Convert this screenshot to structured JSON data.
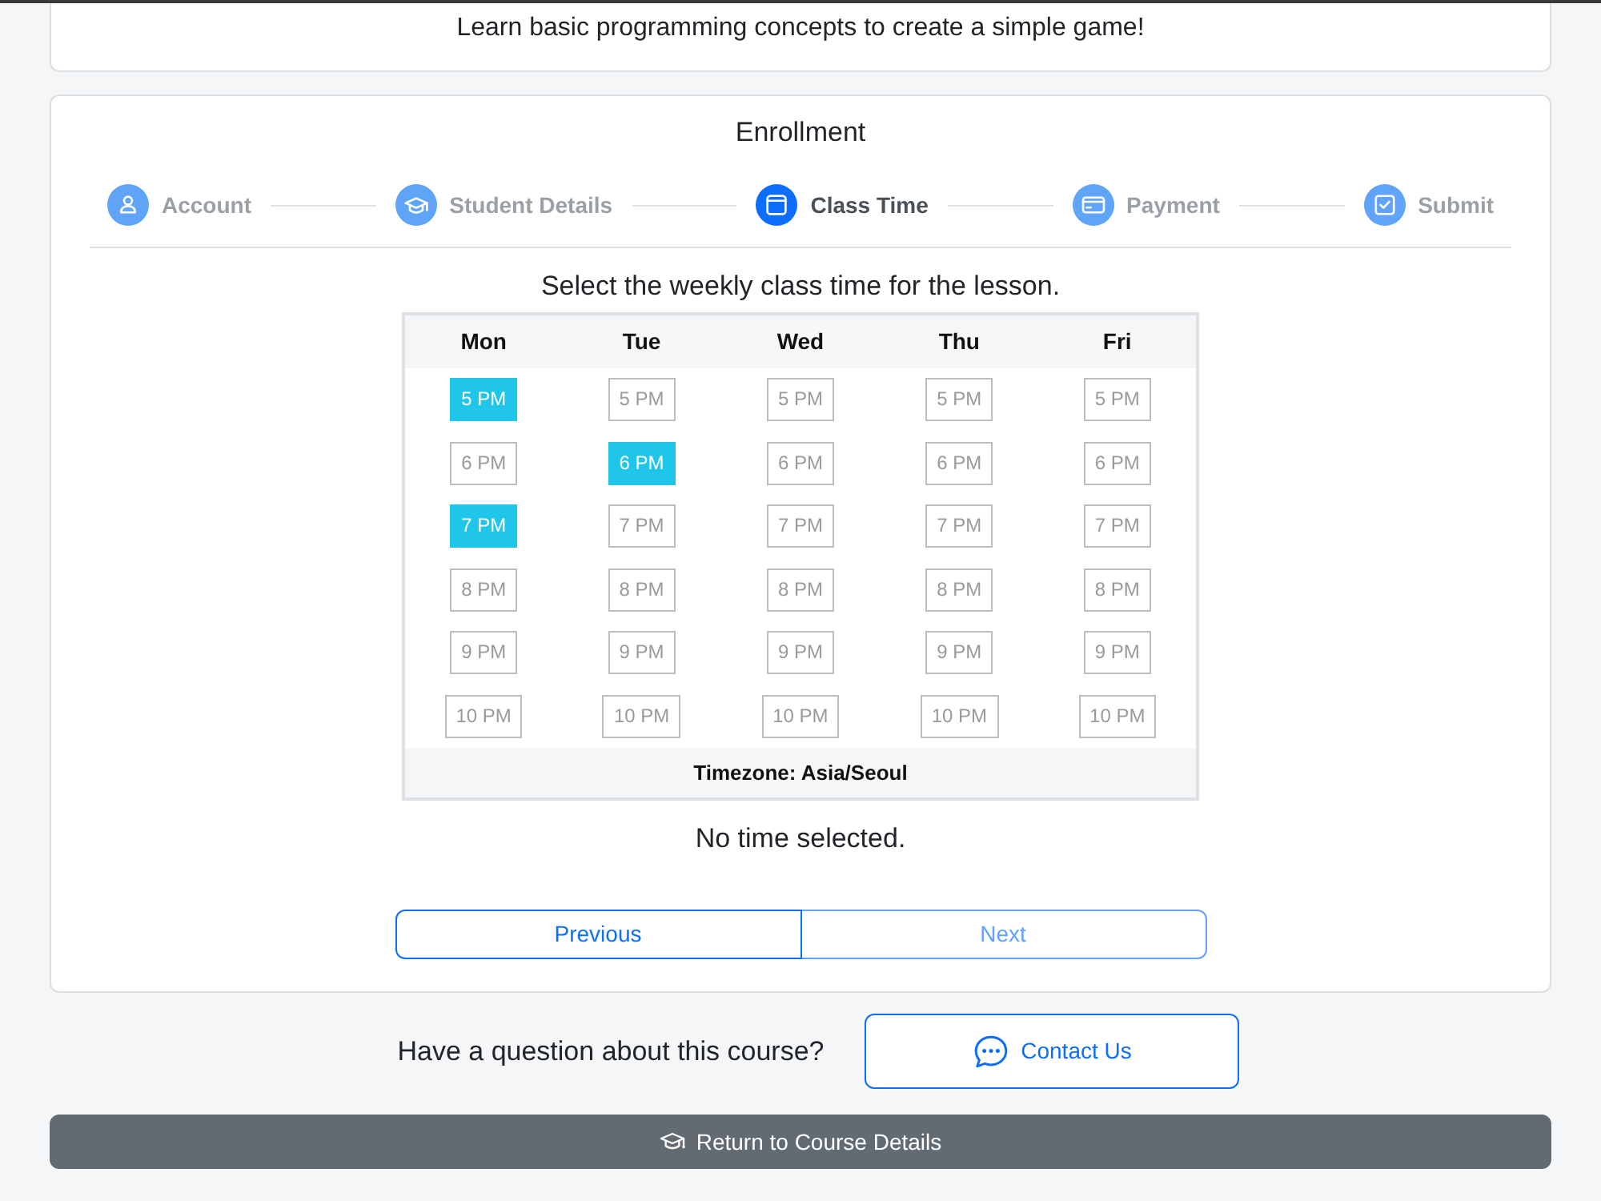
{
  "course_card": {
    "description": "Learn basic programming concepts to create a simple game!"
  },
  "enrollment": {
    "title": "Enrollment",
    "steps": [
      {
        "label": "Account",
        "selected": false
      },
      {
        "label": "Student Details",
        "selected": false
      },
      {
        "label": "Class Time",
        "selected": true
      },
      {
        "label": "Payment",
        "selected": false
      },
      {
        "label": "Submit",
        "selected": false
      }
    ],
    "prompt": "Select the weekly class time for the lesson.",
    "schedule": {
      "days": [
        {
          "label": "Mon",
          "slots": [
            {
              "label": "5 PM",
              "selected": true
            },
            {
              "label": "6 PM",
              "selected": false
            },
            {
              "label": "7 PM",
              "selected": true
            },
            {
              "label": "8 PM",
              "selected": false
            },
            {
              "label": "9 PM",
              "selected": false
            },
            {
              "label": "10 PM",
              "selected": false
            }
          ]
        },
        {
          "label": "Tue",
          "slots": [
            {
              "label": "5 PM",
              "selected": false
            },
            {
              "label": "6 PM",
              "selected": true
            },
            {
              "label": "7 PM",
              "selected": false
            },
            {
              "label": "8 PM",
              "selected": false
            },
            {
              "label": "9 PM",
              "selected": false
            },
            {
              "label": "10 PM",
              "selected": false
            }
          ]
        },
        {
          "label": "Wed",
          "slots": [
            {
              "label": "5 PM",
              "selected": false
            },
            {
              "label": "6 PM",
              "selected": false
            },
            {
              "label": "7 PM",
              "selected": false
            },
            {
              "label": "8 PM",
              "selected": false
            },
            {
              "label": "9 PM",
              "selected": false
            },
            {
              "label": "10 PM",
              "selected": false
            }
          ]
        },
        {
          "label": "Thu",
          "slots": [
            {
              "label": "5 PM",
              "selected": false
            },
            {
              "label": "6 PM",
              "selected": false
            },
            {
              "label": "7 PM",
              "selected": false
            },
            {
              "label": "8 PM",
              "selected": false
            },
            {
              "label": "9 PM",
              "selected": false
            },
            {
              "label": "10 PM",
              "selected": false
            }
          ]
        },
        {
          "label": "Fri",
          "slots": [
            {
              "label": "5 PM",
              "selected": false
            },
            {
              "label": "6 PM",
              "selected": false
            },
            {
              "label": "7 PM",
              "selected": false
            },
            {
              "label": "8 PM",
              "selected": false
            },
            {
              "label": "9 PM",
              "selected": false
            },
            {
              "label": "10 PM",
              "selected": false
            }
          ]
        }
      ],
      "timezone": "Timezone: Asia/Seoul"
    },
    "status": "No time selected.",
    "buttons": [
      {
        "label": "Previous",
        "disabled": false
      },
      {
        "label": "Next",
        "disabled": true
      }
    ]
  },
  "contact": {
    "question": "Have a question about this course?",
    "button": "Contact Us"
  },
  "return_button": "Return to Course Details"
}
